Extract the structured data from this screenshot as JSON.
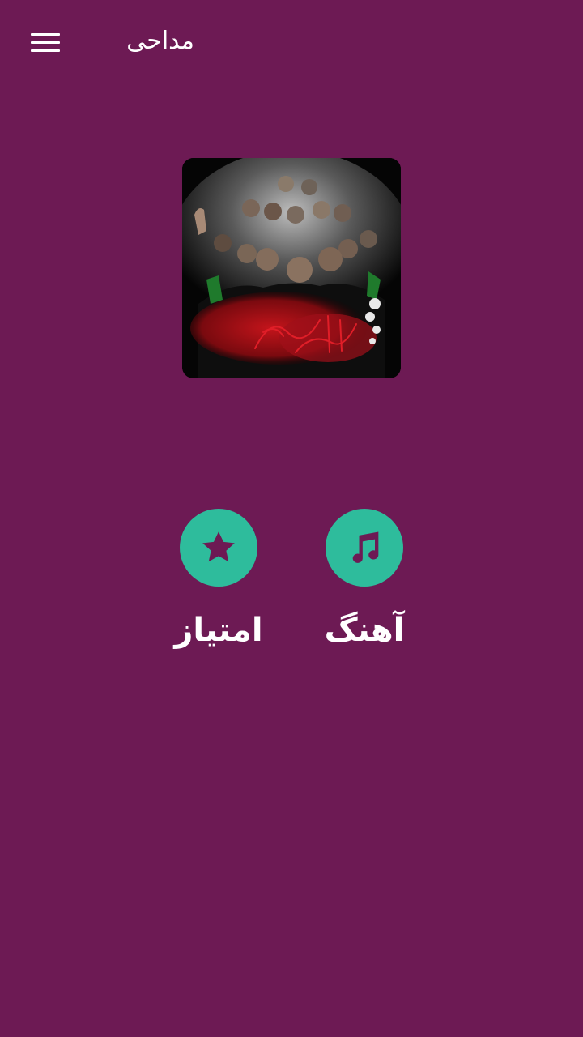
{
  "app_bar": {
    "title": "مداحی",
    "menu_icon": "hamburger-menu-icon"
  },
  "hero_image": {
    "description": "poster-of-eulogy-singers",
    "calligraphy": "السلام علیک یا ابا عبدالله الحسین"
  },
  "actions": [
    {
      "label": "امتیاز",
      "icon": "star-icon"
    },
    {
      "label": "آهنگ",
      "icon": "music-note-icon"
    }
  ],
  "colors": {
    "background": "#6d1a54",
    "accent": "#2ebc9c",
    "text": "#ffffff"
  }
}
